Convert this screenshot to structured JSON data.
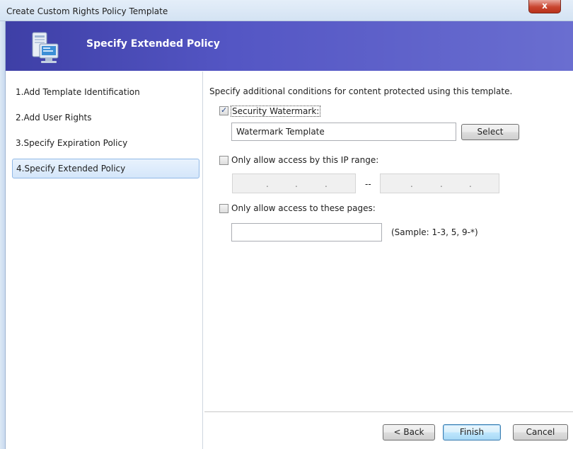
{
  "window": {
    "title": "Create Custom Rights Policy Template",
    "close_glyph": "x"
  },
  "banner": {
    "title": "Specify Extended Policy",
    "icon": "computer-icon"
  },
  "sidebar": {
    "items": [
      {
        "label": "1.Add Template Identification"
      },
      {
        "label": "2.Add User Rights"
      },
      {
        "label": "3.Specify Expiration Policy"
      },
      {
        "label": "4.Specify Extended Policy",
        "active": true
      }
    ]
  },
  "main": {
    "intro": "Specify additional conditions for content protected using this template.",
    "watermark": {
      "label": "Security Watermark:",
      "checked": true,
      "value": "Watermark Template",
      "select_button": "Select"
    },
    "ip_range": {
      "label": "Only allow access by this IP range:",
      "checked": false,
      "separator": "--"
    },
    "pages": {
      "label": "Only allow access to these pages:",
      "checked": false,
      "value": "",
      "sample": "(Sample: 1-3, 5, 9-*)"
    }
  },
  "footer": {
    "back": "< Back",
    "finish": "Finish",
    "cancel": "Cancel"
  },
  "colors": {
    "banner": "#4a4bb5",
    "active_nav": "#d4e6fa",
    "close": "#c9452f"
  }
}
